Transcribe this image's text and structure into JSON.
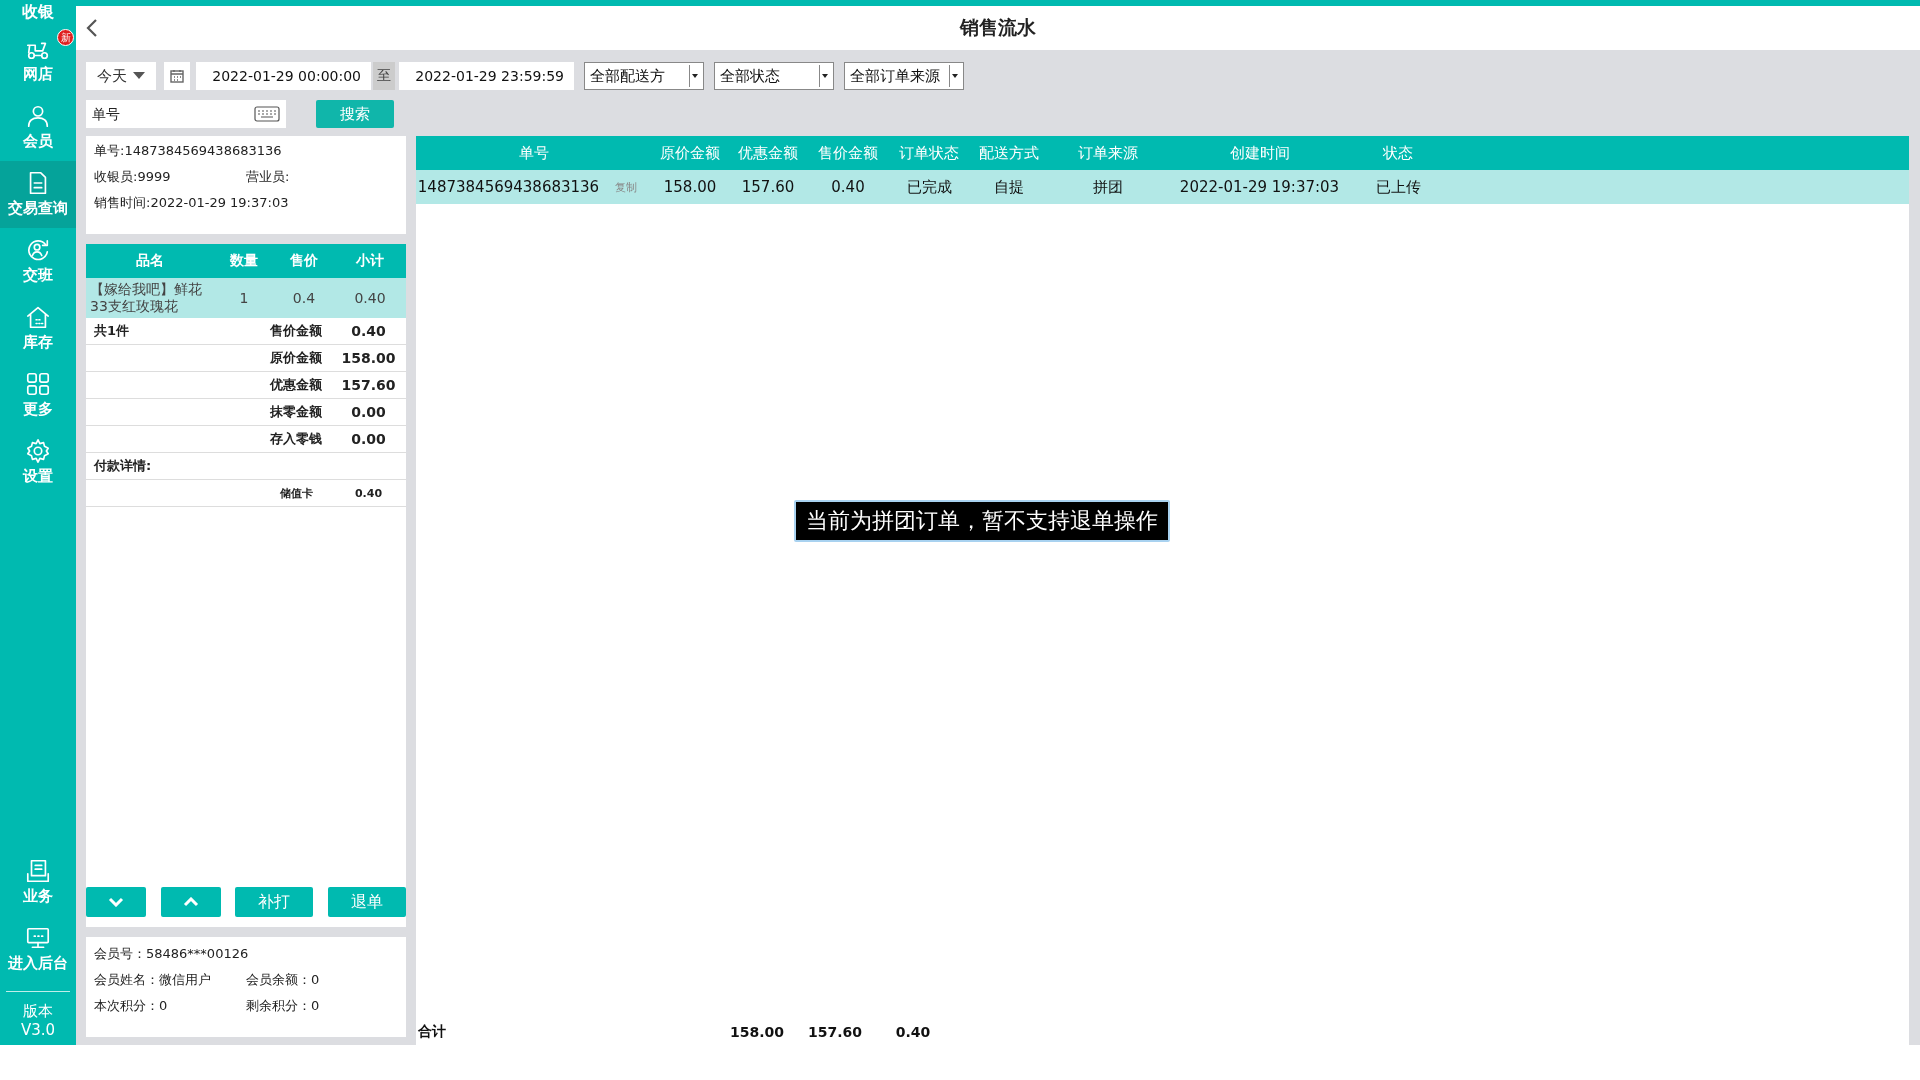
{
  "sidebar": {
    "top_label": "收银",
    "items": [
      {
        "label": "网店",
        "badge": "新",
        "selected": false
      },
      {
        "label": "会员",
        "selected": false
      },
      {
        "label": "交易查询",
        "selected": true
      },
      {
        "label": "交班",
        "selected": false
      },
      {
        "label": "库存",
        "selected": false
      },
      {
        "label": "更多",
        "selected": false
      },
      {
        "label": "设置",
        "selected": false
      }
    ],
    "bottom_items": [
      {
        "label": "业务"
      },
      {
        "label": "进入后台"
      }
    ],
    "version": [
      "版本",
      "V3.0"
    ]
  },
  "header": {
    "title": "销售流水"
  },
  "filters": {
    "period": "今天",
    "start": "2022-01-29 00:00:00",
    "separator": "至",
    "end": "2022-01-29 23:59:59",
    "dropdowns": [
      "全部配送方",
      "全部状态",
      "全部订单来源"
    ],
    "search": {
      "placeholder": "单号"
    },
    "search_button": "搜索"
  },
  "order_info": {
    "order_no": "单号:1487384569438683136",
    "cashier": "收银员:9999",
    "salesperson": "营业员:",
    "time": "销售时间:2022-01-29 19:37:03"
  },
  "items_table": {
    "columns": [
      "品名",
      "数量",
      "售价",
      "小计"
    ],
    "rows": [
      {
        "cells": [
          "【嫁给我吧】鲜花33支红玫瑰花",
          "1",
          "0.4",
          "0.40"
        ],
        "selected": true
      }
    ]
  },
  "summary": {
    "count": "共1件",
    "lines": [
      {
        "label": "售价金额",
        "value": "0.40"
      },
      {
        "label": "原价金额",
        "value": "158.00"
      },
      {
        "label": "优惠金额",
        "value": "157.60"
      },
      {
        "label": "抹零金额",
        "value": "0.00"
      },
      {
        "label": "存入零钱",
        "value": "0.00"
      }
    ]
  },
  "payment": {
    "title": "付款详情:",
    "lines": [
      {
        "label": "储值卡",
        "value": "0.40"
      }
    ]
  },
  "actions": {
    "buttons": [
      "补打",
      "退单"
    ]
  },
  "member": {
    "number": "会员号：58486***00126",
    "pairs": [
      [
        "会员姓名：微信用户",
        "会员余额：0"
      ],
      [
        "本次积分：0",
        "剩余积分：0"
      ]
    ]
  },
  "orders": {
    "columns": [
      "单号",
      "原价金额",
      "优惠金额",
      "售价金额",
      "订单状态",
      "配送方式",
      "订单来源",
      "创建时间",
      "状态"
    ],
    "rows": [
      {
        "cells": [
          "1487384569438683136",
          "158.00",
          "157.60",
          "0.40",
          "已完成",
          "自提",
          "拼团",
          "2022-01-29 19:37:03",
          "已上传"
        ],
        "copy": "复制",
        "selected": true
      }
    ],
    "totals": {
      "label": "合计",
      "values": [
        "158.00",
        "157.60",
        "0.40"
      ]
    }
  },
  "toast": "当前为拼团订单，暂不支持退单操作"
}
